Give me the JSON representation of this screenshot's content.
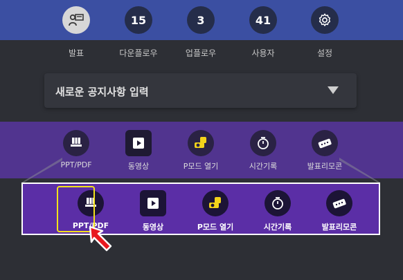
{
  "top_nav": {
    "items": [
      {
        "id": "presentation",
        "badge": "",
        "label": "발표"
      },
      {
        "id": "download-flow",
        "badge": "15",
        "label": "다운플로우"
      },
      {
        "id": "upload-flow",
        "badge": "3",
        "label": "업플로우"
      },
      {
        "id": "users",
        "badge": "41",
        "label": "사용자"
      },
      {
        "id": "settings",
        "badge": "",
        "label": "설정"
      }
    ]
  },
  "notice": {
    "placeholder": "새로운 공지사항 입력"
  },
  "tools": {
    "items": [
      {
        "id": "ppt",
        "label": "PPT/PDF"
      },
      {
        "id": "video",
        "label": "동영상"
      },
      {
        "id": "pmode",
        "label": "P모드 열기"
      },
      {
        "id": "timer",
        "label": "시간기록"
      },
      {
        "id": "remote",
        "label": "발표리모콘"
      }
    ]
  },
  "zoom_panel": {
    "items": [
      {
        "id": "ppt",
        "label": "PPT/PDF"
      },
      {
        "id": "video",
        "label": "동영상"
      },
      {
        "id": "pmode",
        "label": "P모드 열기"
      },
      {
        "id": "timer",
        "label": "시간기록"
      },
      {
        "id": "remote",
        "label": "발표리모콘"
      }
    ],
    "highlighted": "ppt"
  },
  "colors": {
    "top_bar": "#3b4fa2",
    "purple_band": "#51348f",
    "zoom_panel": "#5b2ea6",
    "highlight": "#f3e21a",
    "pointer": "#e8191f",
    "pmode_icon": "#f2d31a"
  }
}
